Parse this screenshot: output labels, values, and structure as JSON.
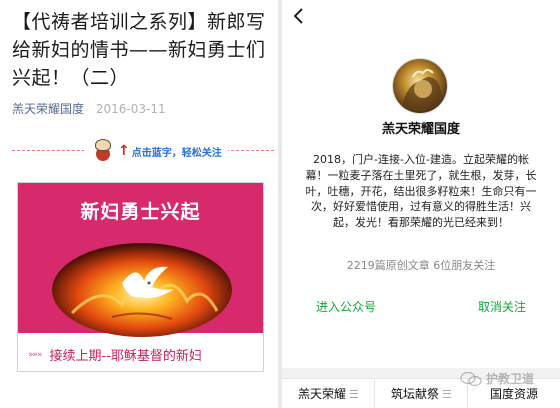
{
  "article": {
    "title": "【代祷者培训之系列】新郎写给新妇的情书——新妇勇士们兴起！（二）",
    "author": "羔天荣耀国度",
    "date": "2016-03-11",
    "follow_prompt": "点击蓝字，轻松关注",
    "promo": {
      "title": "新妇勇士兴起",
      "caption_marker": "»»»",
      "caption": "接续上期--耶稣基督的新妇"
    }
  },
  "profile": {
    "back_icon": "back-chevron-icon",
    "name": "羔天荣耀国度",
    "intro": "2018，门户-连接-入位-建造。立起荣耀的帐幕！一粒麦子落在土里死了，就生根，发芽，长叶，吐穗，开花，结出很多籽粒来！生命只有一次，好好爱惜使用，过有意义的得胜生活！兴起，发光！看那荣耀的光已经来到！",
    "stats": "2219篇原创文章  6位朋友关注",
    "enter_label": "进入公众号",
    "cancel_label": "取消关注",
    "accent_color": "#0fa83b"
  },
  "bottom_menu": [
    {
      "label": "羔天荣耀"
    },
    {
      "label": "筑坛献祭"
    },
    {
      "label": "国度资源"
    }
  ],
  "watermark": "护教卫道",
  "colors": {
    "promo_background": "#d72a6d",
    "author_link": "#576b95",
    "follow_text": "#2a6fd6"
  }
}
